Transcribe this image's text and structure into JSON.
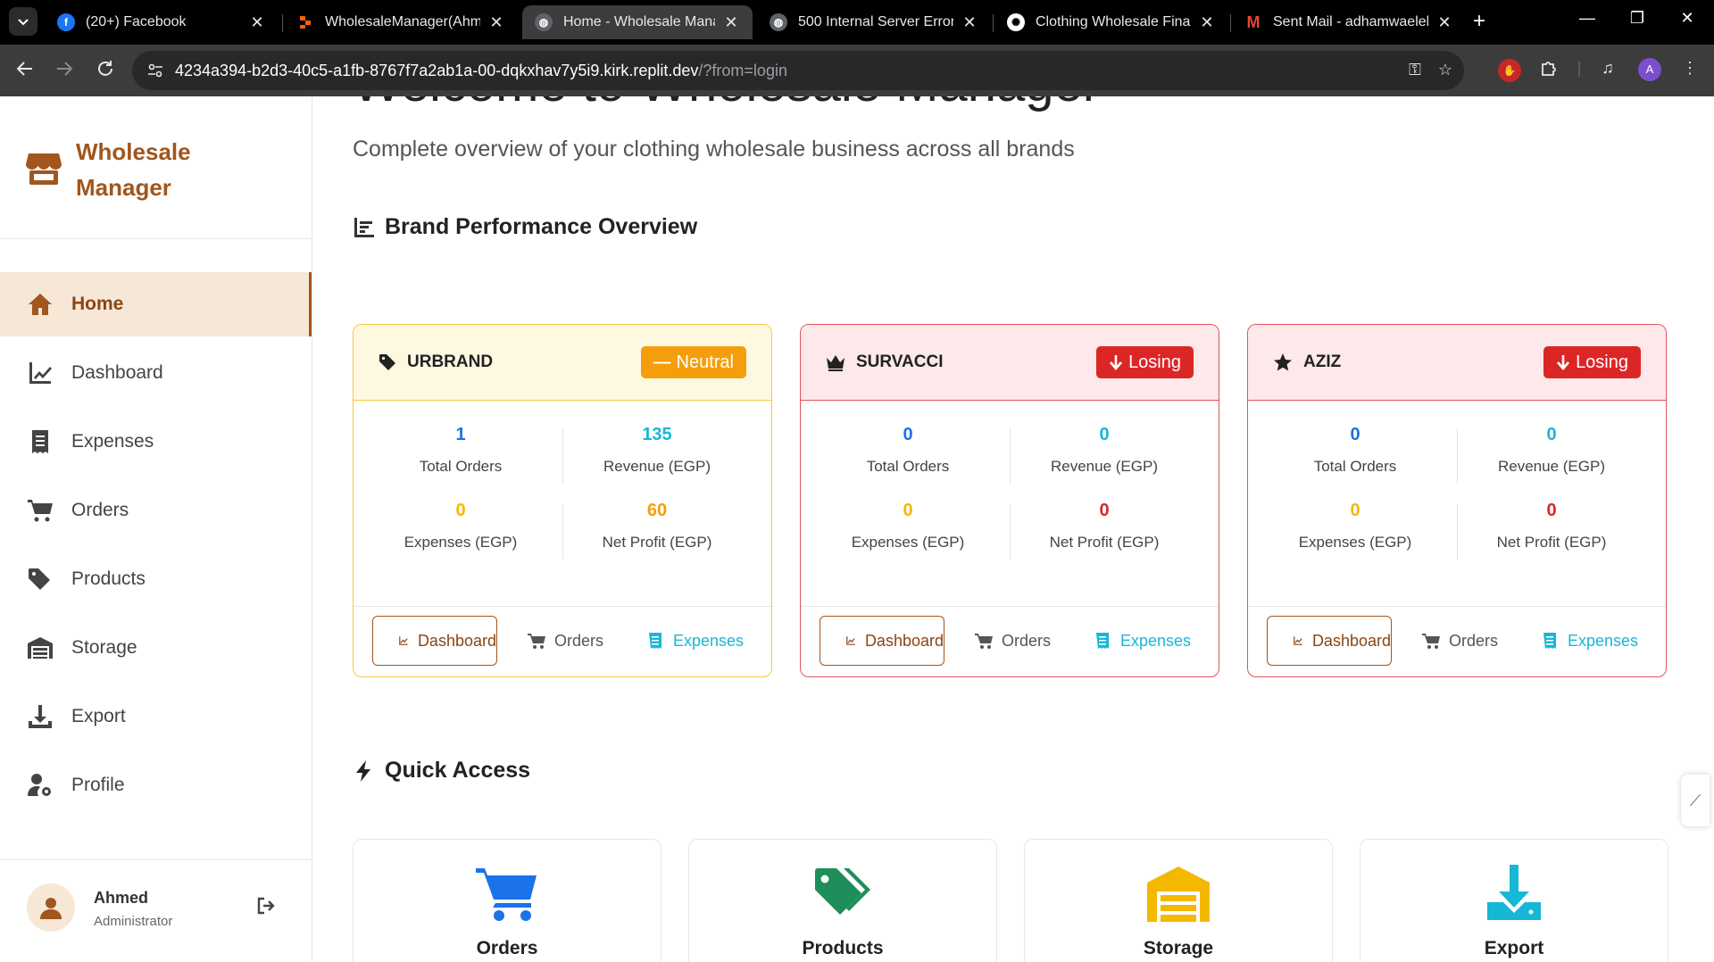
{
  "browser": {
    "tabs": [
      {
        "title": "(20+) Facebook",
        "favicon": "facebook-icon",
        "color": "#1877f2"
      },
      {
        "title": "WholesaleManager(Ahmed",
        "favicon": "replit-icon",
        "color": "#f26207"
      },
      {
        "title": "Home - Wholesale Manage",
        "favicon": "globe-icon",
        "color": "#9aa0a6"
      },
      {
        "title": "500 Internal Server Error",
        "favicon": "globe-icon",
        "color": "#9aa0a6"
      },
      {
        "title": "Clothing Wholesale Financ",
        "favicon": "openai-icon",
        "color": "#9aa0a6"
      },
      {
        "title": "Sent Mail - adhamwaelelk",
        "favicon": "gmail-icon",
        "color": "#ea4335"
      }
    ],
    "url_main": "4234a394-b2d3-40c5-a1fb-8767f7a2ab1a-00-dqkxhav7y5i9.kirk.replit.dev",
    "url_rest": "/?from=login",
    "profile_initial": "A"
  },
  "sidebar": {
    "brand_name": "Wholesale Manager",
    "items": [
      {
        "label": "Home",
        "icon": "home-icon"
      },
      {
        "label": "Dashboard",
        "icon": "chart-line-icon"
      },
      {
        "label": "Expenses",
        "icon": "receipt-icon"
      },
      {
        "label": "Orders",
        "icon": "cart-icon"
      },
      {
        "label": "Products",
        "icon": "tags-icon"
      },
      {
        "label": "Storage",
        "icon": "warehouse-icon"
      },
      {
        "label": "Export",
        "icon": "download-icon"
      },
      {
        "label": "Profile",
        "icon": "user-cog-icon"
      }
    ],
    "user": {
      "name": "Ahmed",
      "role": "Administrator"
    }
  },
  "main": {
    "welcome": "Welcome to Wholesale Manager",
    "subtitle": "Complete overview of your clothing wholesale business across all brands",
    "brand_section_title": "Brand Performance Overview",
    "quick_access_title": "Quick Access",
    "brands": [
      {
        "name": "URBRAND",
        "icon": "tag-icon",
        "status": "Neutral",
        "status_icon": "minus-icon",
        "status_color": "#f59e0b",
        "head_bg": "#fff8e1",
        "border": "#f5c842",
        "total_orders": "1",
        "revenue": "135",
        "expenses": "0",
        "net_profit": "60",
        "net_profit_color": "#f59e0b"
      },
      {
        "name": "SURVACCI",
        "icon": "crown-icon",
        "status": "Losing",
        "status_icon": "arrow-down-icon",
        "status_color": "#dc2626",
        "head_bg": "#fde8ea",
        "border": "#e05260",
        "total_orders": "0",
        "revenue": "0",
        "expenses": "0",
        "net_profit": "0",
        "net_profit_color": "#dc2626"
      },
      {
        "name": "AZIZ",
        "icon": "star-icon",
        "status": "Losing",
        "status_icon": "arrow-down-icon",
        "status_color": "#dc2626",
        "head_bg": "#fde8ea",
        "border": "#e05260",
        "total_orders": "0",
        "revenue": "0",
        "expenses": "0",
        "net_profit": "0",
        "net_profit_color": "#dc2626"
      }
    ],
    "stat_labels": {
      "total_orders": "Total Orders",
      "revenue": "Revenue (EGP)",
      "expenses": "Expenses (EGP)",
      "net_profit": "Net Profit (EGP)"
    },
    "card_actions": {
      "dashboard": "Dashboard",
      "orders": "Orders",
      "expenses": "Expenses"
    },
    "quick_access": [
      {
        "label": "Orders",
        "icon": "cart-icon",
        "color": "#1a73e8"
      },
      {
        "label": "Products",
        "icon": "tags-icon",
        "color": "#1e8e5a"
      },
      {
        "label": "Storage",
        "icon": "warehouse-icon",
        "color": "#f5b800"
      },
      {
        "label": "Export",
        "icon": "download-icon",
        "color": "#17b7d6"
      }
    ]
  },
  "colors": {
    "accent": "#a0561d",
    "orders_blue": "#1a73e8",
    "revenue_cyan": "#17b7d6",
    "expenses_yellow": "#f5b800"
  }
}
